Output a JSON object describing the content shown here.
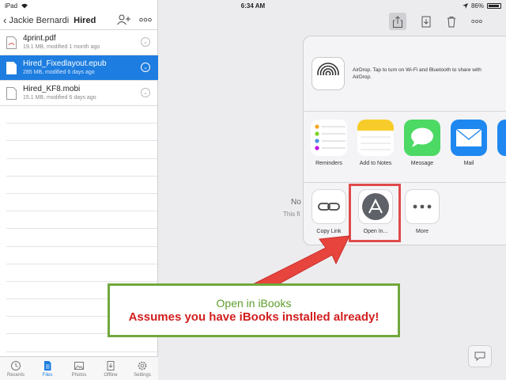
{
  "status_bar": {
    "device": "iPad",
    "time": "6:34 AM",
    "battery": "86%"
  },
  "left_pane": {
    "back_label": "Jackie Bernardi",
    "folder_title": "Hired",
    "files": [
      {
        "name": "4print.pdf",
        "meta": "19.1 MB, modified 1 month ago",
        "selected": false
      },
      {
        "name": "Hired_Fixedlayout.epub",
        "meta": "285 MB, modified 6 days ago",
        "selected": true
      },
      {
        "name": "Hired_KF8.mobi",
        "meta": "15.1 MB, modified 6 days ago",
        "selected": false
      }
    ],
    "tabs": [
      {
        "label": "Recents",
        "icon": "clock-icon"
      },
      {
        "label": "Files",
        "icon": "file-icon",
        "active": true
      },
      {
        "label": "Photos",
        "icon": "photo-icon"
      },
      {
        "label": "Offline",
        "icon": "download-icon"
      },
      {
        "label": "Settings",
        "icon": "gear-icon"
      }
    ]
  },
  "right_pane": {
    "bg_message": "No",
    "bg_message2": "This fi"
  },
  "share_sheet": {
    "airdrop_text": "AirDrop. Tap to turn on Wi-Fi and Bluetooth to share with AirDrop.",
    "apps": [
      {
        "label": "Reminders"
      },
      {
        "label": "Add to Notes"
      },
      {
        "label": "Message"
      },
      {
        "label": "Mail"
      }
    ],
    "actions": [
      {
        "label": "Copy Link"
      },
      {
        "label": "Open In..."
      },
      {
        "label": "More"
      }
    ]
  },
  "callout": {
    "line1": "Open in iBooks",
    "line2": "Assumes you have iBooks installed already!"
  },
  "colors": {
    "accent": "#1d7de0",
    "callout_border": "#71a83c",
    "warning_red": "#d21f1f"
  }
}
